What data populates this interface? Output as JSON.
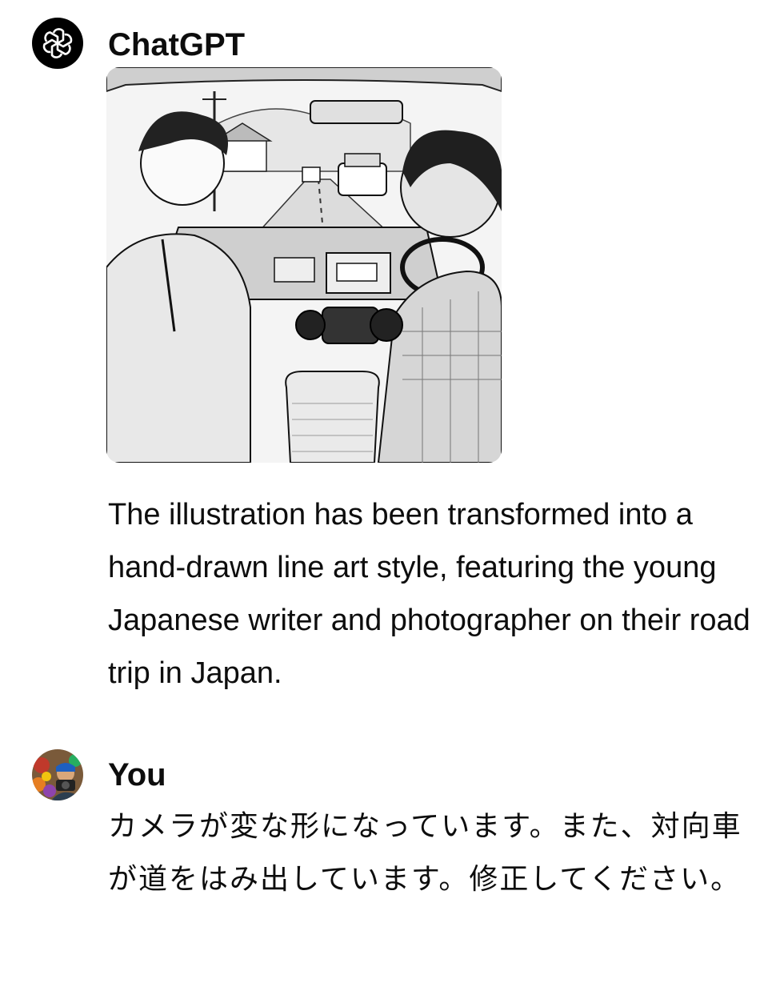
{
  "assistant_message": {
    "author": "ChatGPT",
    "avatar_icon": "openai-logo-icon",
    "image": {
      "description_icon": "line-art-car-interior-image",
      "style": "black-and-white line art"
    },
    "text": "The illustration has been transformed into a hand-drawn line art style, featuring the young Japanese writer and photographer on their road trip in Japan."
  },
  "user_message": {
    "author": "You",
    "avatar_icon": "user-photo-avatar",
    "text": "カメラが変な形になっています。また、対向車が道をはみ出しています。修正してください。"
  },
  "colors": {
    "text": "#0d0d0d",
    "background": "#ffffff",
    "gpt_avatar_bg": "#000000"
  }
}
